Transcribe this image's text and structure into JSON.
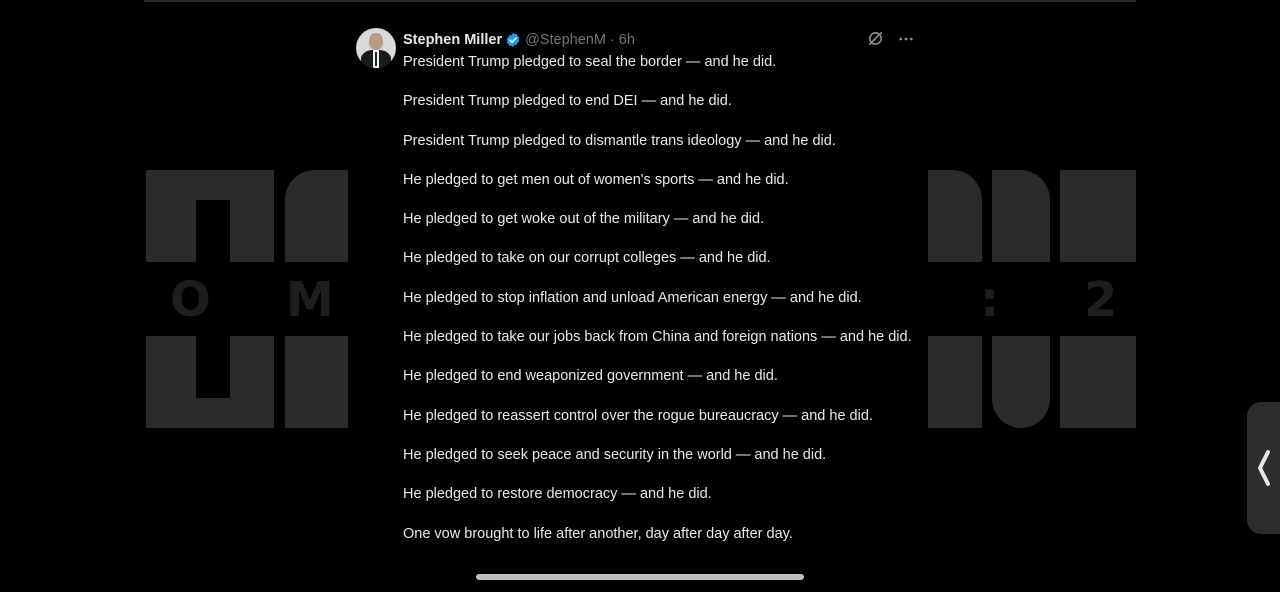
{
  "background": {
    "letters": [
      "O",
      "M",
      ":",
      "2"
    ]
  },
  "tweet": {
    "author": {
      "name": "Stephen Miller",
      "handle": "@StephenM",
      "separator": "·",
      "time": "6h",
      "verified_color": "#1d9bf0"
    },
    "icons": [
      "grok-icon",
      "more-icon"
    ],
    "paragraphs": [
      "President Trump pledged to seal the border — and he did.",
      "President Trump pledged to end DEI — and he did.",
      "President Trump pledged to dismantle trans ideology — and he did.",
      "He pledged to get men out of women's sports — and he did.",
      "He pledged to get woke out of the military — and he did.",
      "He pledged to take on our corrupt colleges — and he did.",
      "He pledged to stop inflation and unload American energy — and he did.",
      "He pledged to take our jobs back from China and foreign nations — and he did.",
      "He pledged to end weaponized government — and he did.",
      "He pledged to reassert control over the rogue bureaucracy — and he did.",
      "He pledged to seek peace and security in the world — and he did.",
      "He pledged to restore democracy — and he did.",
      "One vow brought to life after another, day after day after day."
    ]
  },
  "colors": {
    "text_primary": "#e7e9ea",
    "text_secondary": "#71767b",
    "accent": "#1d9bf0",
    "background": "#000000"
  }
}
